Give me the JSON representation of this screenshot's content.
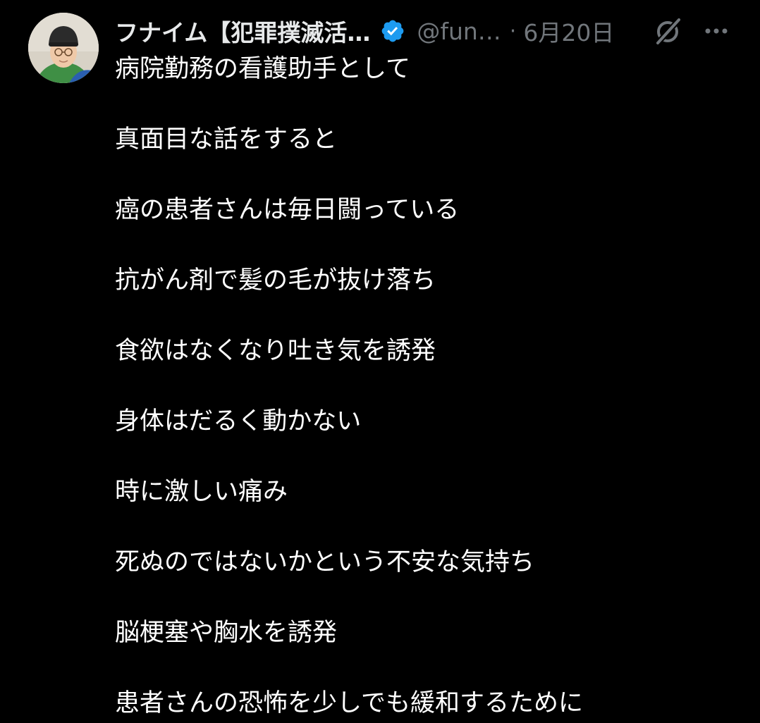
{
  "tweet": {
    "author": {
      "display_name": "フナイム【犯罪撲滅活…",
      "handle": "@fun…",
      "verified": true,
      "avatar_icon": "profile-photo"
    },
    "separator": "·",
    "timestamp": "6月20日",
    "icons": {
      "verified": "verified-badge-icon",
      "grok": "grok-icon",
      "more": "more-options-icon"
    },
    "lines": [
      "病院勤務の看護助手として",
      "真面目な話をすると",
      "癌の患者さんは毎日闘っている",
      "抗がん剤で髪の毛が抜け落ち",
      "食欲はなくなり吐き気を誘発",
      "身体はだるく動かない",
      "時に激しい痛み",
      "死ぬのではないかという不安な気持ち",
      "脳梗塞や胸水を誘発",
      "患者さんの恐怖を少しでも緩和するために"
    ]
  },
  "colors": {
    "background": "#000000",
    "text": "#ffffff",
    "secondary": "#71767b",
    "verified": "#1d9bf0"
  }
}
